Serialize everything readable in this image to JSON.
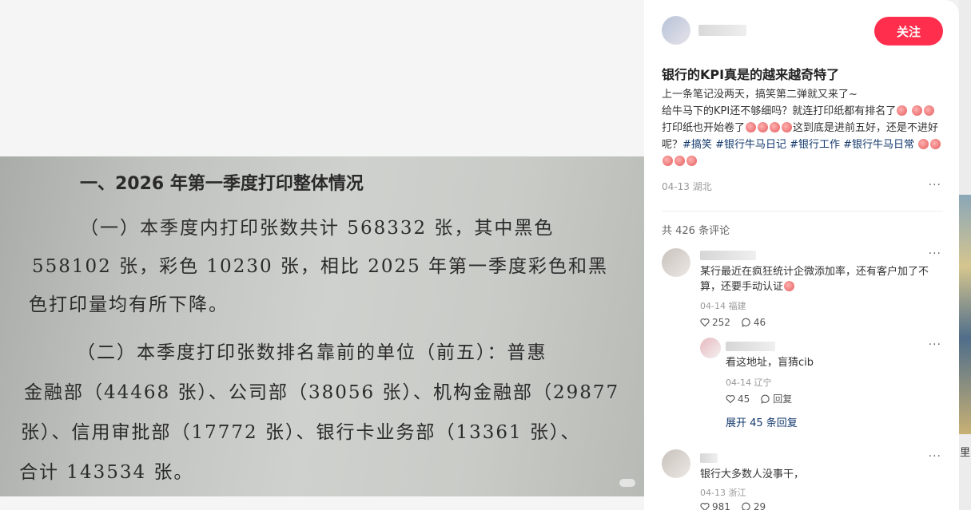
{
  "image": {
    "heading": "一、2026 年第一季度打印整体情况",
    "lines": [
      "（一）本季度内打印张数共计 568332 张，其中黑色",
      "558102 张，彩色 10230 张，相比 2025 年第一季度彩色和黑",
      "色打印量均有所下降。",
      "（二）本季度打印张数排名靠前的单位（前五）：普惠",
      "金融部（44468 张）、公司部（38056 张）、机构金融部（29877",
      "张）、信用审批部（17772 张）、银行卡业务部（13361 张）、",
      "合计 143534 张。"
    ]
  },
  "note": {
    "author_name": "",
    "follow_label": "关注",
    "title": "银行的KPI真是的越来越奇特了",
    "body": {
      "p1": "上一条笔记没两天，搞笑第二弹就又来了~",
      "p2a": "给牛马下的KPI还不够细吗？就连打印纸都有排名了",
      "p2b": "打印纸也开始卷了",
      "p2c": "这到底是进前五好，还是不进好呢？",
      "tags": [
        "#搞笑",
        "#银行牛马日记",
        "#银行工作",
        "#银行牛马日常"
      ]
    },
    "meta": "04-13 湖北",
    "more": "···",
    "comment_count": "共 426 条评论"
  },
  "comments": [
    {
      "text": "某行最近在疯狂统计企微添加率，还有客户加了不算，还要手动认证",
      "meta": "04-14 福建",
      "likes": "252",
      "replies": "46"
    },
    {
      "text": "看这地址，盲猜cib",
      "meta": "04-14 辽宁",
      "likes": "45",
      "reply_label": "回复",
      "expand": "展开 45 条回复"
    },
    {
      "text": "银行大多数人没事干，",
      "meta": "04-13 浙江",
      "likes": "981",
      "replies": "29"
    }
  ],
  "strip": {
    "text": "里"
  },
  "icons": [
    "heart-icon",
    "comment-icon",
    "more-icon"
  ],
  "colors": {
    "accent": "#ff2e4d",
    "tag": "#13386c"
  }
}
